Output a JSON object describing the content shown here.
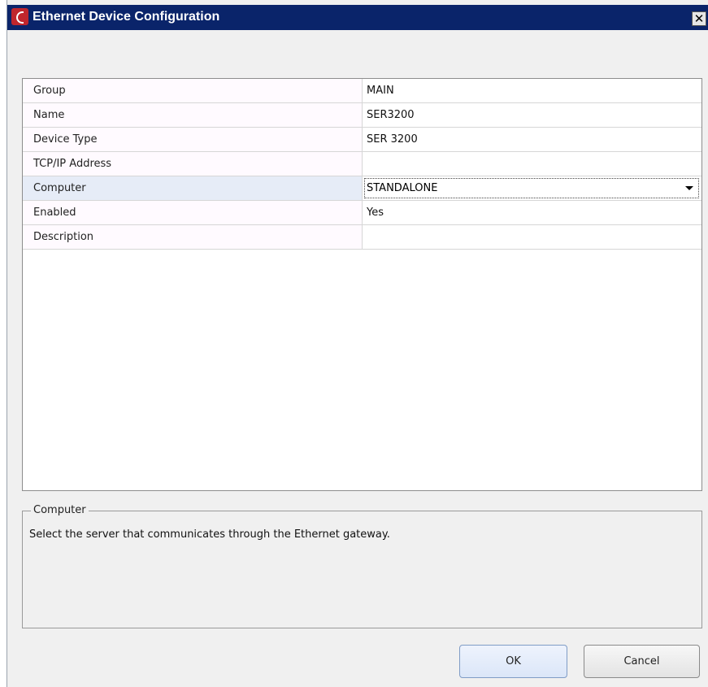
{
  "window": {
    "title": "Ethernet Device Configuration",
    "close_glyph": "✕"
  },
  "properties": [
    {
      "name": "Group",
      "value": "MAIN"
    },
    {
      "name": "Name",
      "value": "SER3200"
    },
    {
      "name": "Device Type",
      "value": "SER 3200"
    },
    {
      "name": "TCP/IP Address",
      "value": ""
    },
    {
      "name": "Computer",
      "value": "STANDALONE"
    },
    {
      "name": "Enabled",
      "value": "Yes"
    },
    {
      "name": "Description",
      "value": ""
    }
  ],
  "help": {
    "heading": "Computer",
    "text": "Select the server that communicates through the Ethernet gateway."
  },
  "buttons": {
    "ok": "OK",
    "cancel": "Cancel"
  },
  "colors": {
    "titlebar": "#0a246a",
    "selected_row": "#e6ecf7",
    "icon": "#c0262d"
  }
}
